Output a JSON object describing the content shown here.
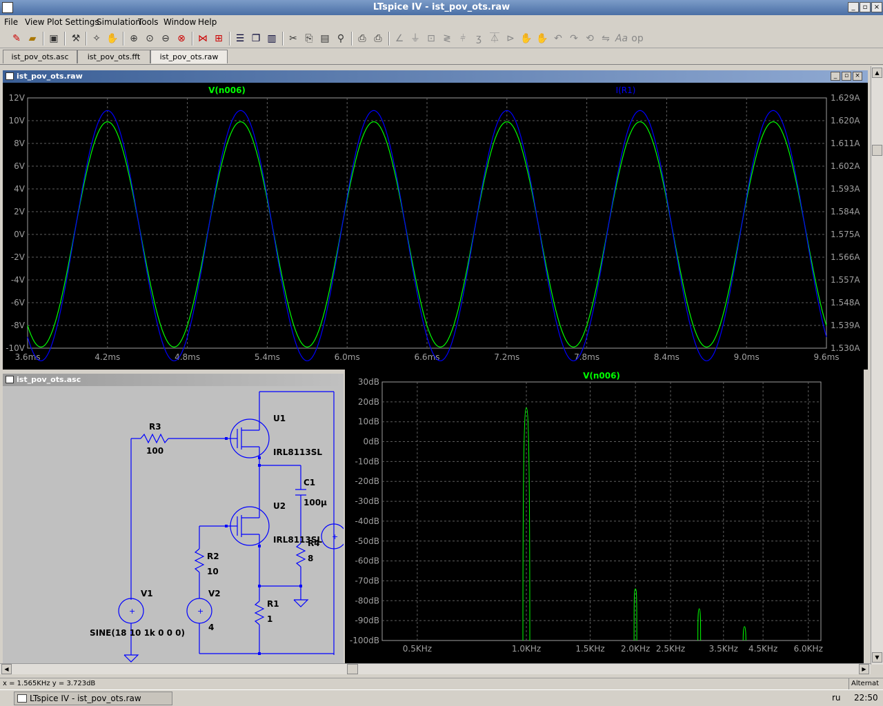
{
  "window": {
    "title": "LTspice IV - ist_pov_ots.raw"
  },
  "menu": [
    "File",
    "View",
    "Plot Settings",
    "Simulation",
    "Tools",
    "Window",
    "Help"
  ],
  "toolbar_icons": [
    "new-schematic-icon",
    "open-icon",
    "save-icon",
    "control-panel-icon",
    "run-icon",
    "halt-icon",
    "zoom-in-icon",
    "zoom-extents-icon",
    "zoom-out-icon",
    "zoom-cancel-icon",
    "autorange-icon",
    "fft-icon",
    "tile-horizontal-icon",
    "cascade-icon",
    "tile-vertical-icon",
    "cut-icon",
    "copy-icon",
    "paste-icon",
    "find-icon",
    "print-preview-icon",
    "print-icon",
    "wire-icon",
    "ground-icon",
    "label-icon",
    "resistor-icon",
    "capacitor-icon",
    "inductor-icon",
    "diode-icon",
    "component-icon",
    "move-icon",
    "drag-icon",
    "undo-icon",
    "redo-icon",
    "rotate-icon",
    "mirror-icon",
    "text-icon",
    "spice-directive-icon"
  ],
  "tabs": [
    {
      "label": "ist_pov_ots.asc",
      "active": false
    },
    {
      "label": "ist_pov_ots.fft",
      "active": false
    },
    {
      "label": "ist_pov_ots.raw",
      "active": true
    }
  ],
  "wave_window": {
    "title": "ist_pov_ots.raw"
  },
  "schematic_window": {
    "title": "ist_pov_ots.asc",
    "labels": {
      "r3_name": "R3",
      "r3_value": "100",
      "u1_name": "U1",
      "u1_model": "IRL8113SL",
      "c1_name": "C1",
      "c1_value": "100µ",
      "u2_name": "U2",
      "u2_model": "IRL8113SL",
      "r4_name": "R4",
      "r4_value": "8",
      "r2_name": "R2",
      "r2_value": "10",
      "v1_name": "V1",
      "v1_value": "SINE(18 10 1k 0 0 0)",
      "v2_name": "V2",
      "v2_value": "4",
      "r1_name": "R1",
      "r1_value": "1"
    }
  },
  "chart_data": [
    {
      "type": "line",
      "series": [
        {
          "name": "V(n006)",
          "color": "#00ff00",
          "axis": "left",
          "waveform": "sine",
          "amplitude": 9.9,
          "offset": 0.0,
          "frequency_hz": 1000,
          "peak_times_ms": [
            4.2,
            5.2,
            6.2,
            7.2,
            8.2,
            9.2
          ]
        },
        {
          "name": "I(R1)",
          "color": "#0000ff",
          "axis": "right",
          "waveform": "sine",
          "amplitude_A": 0.0495,
          "offset_A": 1.5745,
          "frequency_hz": 1000,
          "peak_times_ms": [
            4.2,
            5.2,
            6.2,
            7.2,
            8.2,
            9.2
          ]
        }
      ],
      "xlim": [
        3.6,
        9.6
      ],
      "x_ticks": [
        "3.6ms",
        "4.2ms",
        "4.8ms",
        "5.4ms",
        "6.0ms",
        "6.6ms",
        "7.2ms",
        "7.8ms",
        "8.4ms",
        "9.0ms",
        "9.6ms"
      ],
      "ylim_left": [
        -10,
        12
      ],
      "y_ticks_left": [
        "12V",
        "10V",
        "8V",
        "6V",
        "4V",
        "2V",
        "0V",
        "-2V",
        "-4V",
        "-6V",
        "-8V",
        "-10V"
      ],
      "ylim_right": [
        1.53,
        1.629
      ],
      "y_ticks_right": [
        "1.629A",
        "1.620A",
        "1.611A",
        "1.602A",
        "1.593A",
        "1.584A",
        "1.575A",
        "1.566A",
        "1.557A",
        "1.548A",
        "1.539A",
        "1.530A"
      ],
      "grid": true
    },
    {
      "type": "line",
      "title": "V(n006)",
      "x_scale": "log",
      "x_ticks": [
        "0.5KHz",
        "1.0KHz",
        "1.5KHz",
        "2.0KHz",
        "2.5KHz",
        "3.5KHz",
        "4.5KHz",
        "6.0KHz"
      ],
      "y_ticks": [
        "30dB",
        "20dB",
        "10dB",
        "0dB",
        "-10dB",
        "-20dB",
        "-30dB",
        "-40dB",
        "-50dB",
        "-60dB",
        "-70dB",
        "-80dB",
        "-90dB",
        "-100dB"
      ],
      "ylim": [
        -100,
        30
      ],
      "peaks": [
        {
          "freq_khz": 1.0,
          "db": 17
        },
        {
          "freq_khz": 2.0,
          "db": -74
        },
        {
          "freq_khz": 3.0,
          "db": -84
        },
        {
          "freq_khz": 4.0,
          "db": -93
        }
      ],
      "color": "#00ff00",
      "grid": true
    }
  ],
  "status": {
    "coords": "x = 1.565KHz    y = 3.723dB",
    "right": "Alternat"
  },
  "taskbar": {
    "task": "LTspice IV - ist_pov_ots.raw",
    "lang": "ru",
    "clock": "22:50"
  }
}
